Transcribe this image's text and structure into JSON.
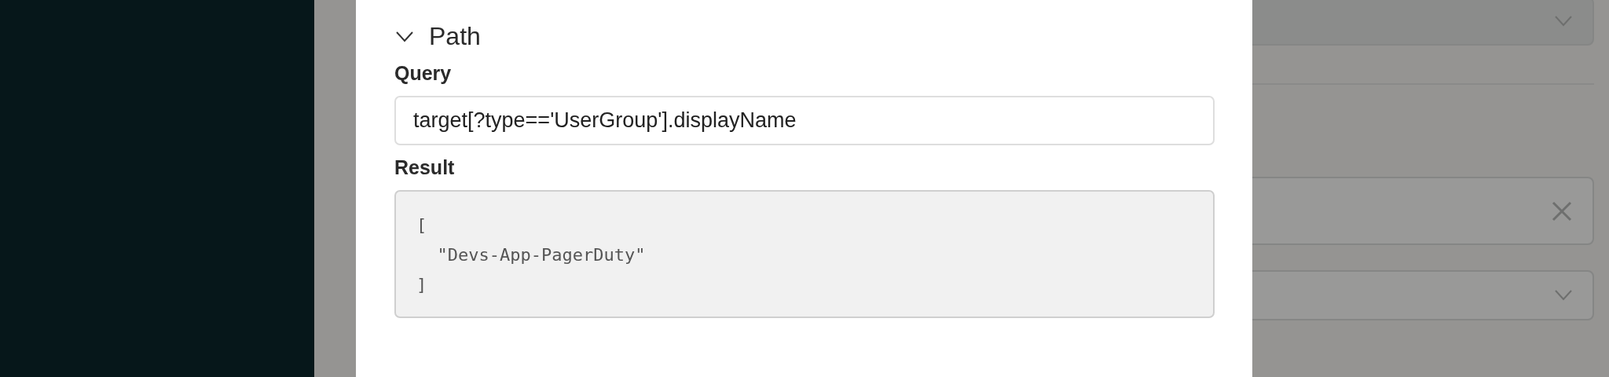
{
  "modal": {
    "section": {
      "title": "Path",
      "expanded": true
    },
    "query": {
      "label": "Query",
      "value": "target[?type=='UserGroup'].displayName"
    },
    "result": {
      "label": "Result",
      "text": "[\n  \"Devs-App-PagerDuty\"\n]"
    }
  }
}
